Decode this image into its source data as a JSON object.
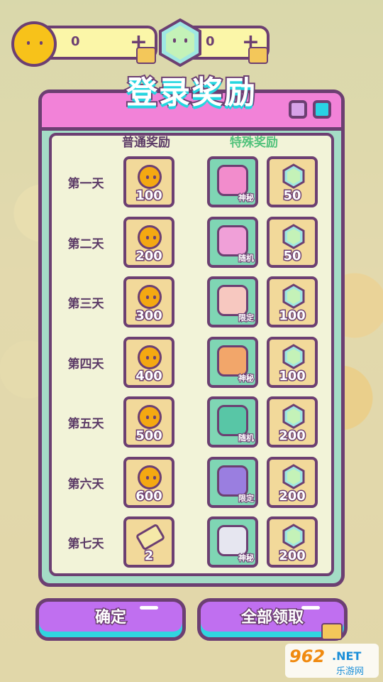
{
  "currency": {
    "coins": {
      "value": "0",
      "plus": "+"
    },
    "gems": {
      "value": "0",
      "plus": "+"
    }
  },
  "dialog": {
    "title": "登录奖励",
    "col_normal": "普通奖励",
    "col_special": "特殊奖励",
    "rows": [
      {
        "day": "第一天",
        "normal": {
          "type": "coin",
          "amount": "100"
        },
        "item_tag": "神秘",
        "item_icon": "robot-gun-icon",
        "gems": "50"
      },
      {
        "day": "第二天",
        "normal": {
          "type": "coin",
          "amount": "200"
        },
        "item_tag": "随机",
        "item_icon": "camera-icon",
        "gems": "50"
      },
      {
        "day": "第三天",
        "normal": {
          "type": "coin",
          "amount": "300"
        },
        "item_tag": "限定",
        "item_icon": "hamster-icon",
        "gems": "100"
      },
      {
        "day": "第四天",
        "normal": {
          "type": "coin",
          "amount": "400"
        },
        "item_tag": "神秘",
        "item_icon": "takoyaki-icon",
        "gems": "100"
      },
      {
        "day": "第五天",
        "normal": {
          "type": "coin",
          "amount": "500"
        },
        "item_tag": "随机",
        "item_icon": "dinosaur-icon",
        "gems": "200"
      },
      {
        "day": "第六天",
        "normal": {
          "type": "coin",
          "amount": "600"
        },
        "item_tag": "限定",
        "item_icon": "bat-icon",
        "gems": "200"
      },
      {
        "day": "第七天",
        "normal": {
          "type": "ticket",
          "amount": "2"
        },
        "item_tag": "神秘",
        "item_icon": "computer-icon",
        "gems": "200"
      }
    ]
  },
  "buttons": {
    "confirm": "确定",
    "claim_all": "全部领取"
  },
  "watermark": {
    "logo": "962",
    "site": ".NET",
    "name": "乐游网"
  },
  "colors": {
    "outline": "#6c3f72",
    "header_pink": "#f282d8",
    "accent_cyan": "#30d5e0",
    "button_purple": "#c06ff0",
    "special_green": "#53c27c"
  }
}
